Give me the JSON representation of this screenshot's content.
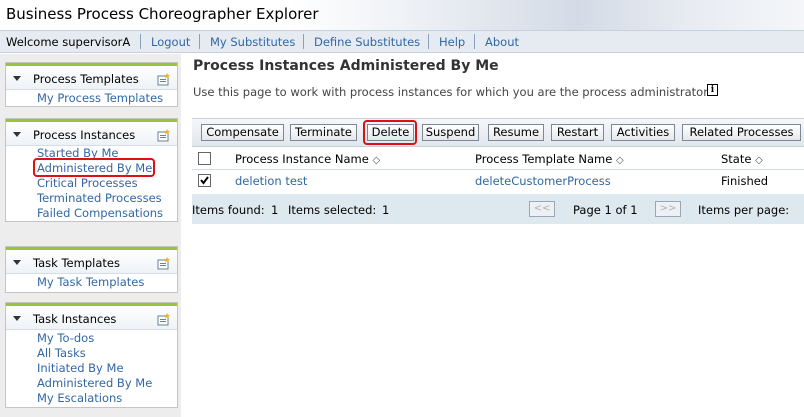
{
  "app": {
    "title": "Business Process Choreographer Explorer"
  },
  "nav": {
    "welcome": "Welcome supervisorA",
    "links": [
      "Logout",
      "My Substitutes",
      "Define Substitutes",
      "Help",
      "About"
    ]
  },
  "sidebar": {
    "process_templates": {
      "heading": "Process Templates",
      "items": [
        "My Process Templates"
      ]
    },
    "process_instances": {
      "heading": "Process Instances",
      "items": [
        "Started By Me",
        "Administered By Me",
        "Critical Processes",
        "Terminated Processes",
        "Failed Compensations"
      ]
    },
    "task_templates": {
      "heading": "Task Templates",
      "items": [
        "My Task Templates"
      ]
    },
    "task_instances": {
      "heading": "Task Instances",
      "items": [
        "My To-dos",
        "All Tasks",
        "Initiated By Me",
        "Administered By Me",
        "My Escalations"
      ]
    }
  },
  "main": {
    "title": "Process Instances Administered By Me",
    "description": "Use this page to work with process instances for which you are the process administrator",
    "info_icon": "i"
  },
  "toolbar": {
    "buttons": [
      "Compensate",
      "Terminate",
      "Delete",
      "Suspend",
      "Resume",
      "Restart",
      "Activities",
      "Related Processes"
    ]
  },
  "table": {
    "columns": [
      "Process Instance Name",
      "Process Template Name",
      "State"
    ],
    "sort_glyph": "◇",
    "rows": [
      {
        "checked": true,
        "instance": "deletion test",
        "template": "deleteCustomerProcess",
        "state": "Finished"
      }
    ]
  },
  "footer": {
    "items_found_label": "Items found:",
    "items_found": "1",
    "items_selected_label": "Items selected:",
    "items_selected": "1",
    "prev": "<<",
    "next": ">>",
    "page_info": "Page 1 of 1",
    "per_page_label": "Items per page:"
  },
  "colors": {
    "link": "#3167a3",
    "accent_bar": "#9ac43b",
    "highlight": "#dd1111"
  }
}
